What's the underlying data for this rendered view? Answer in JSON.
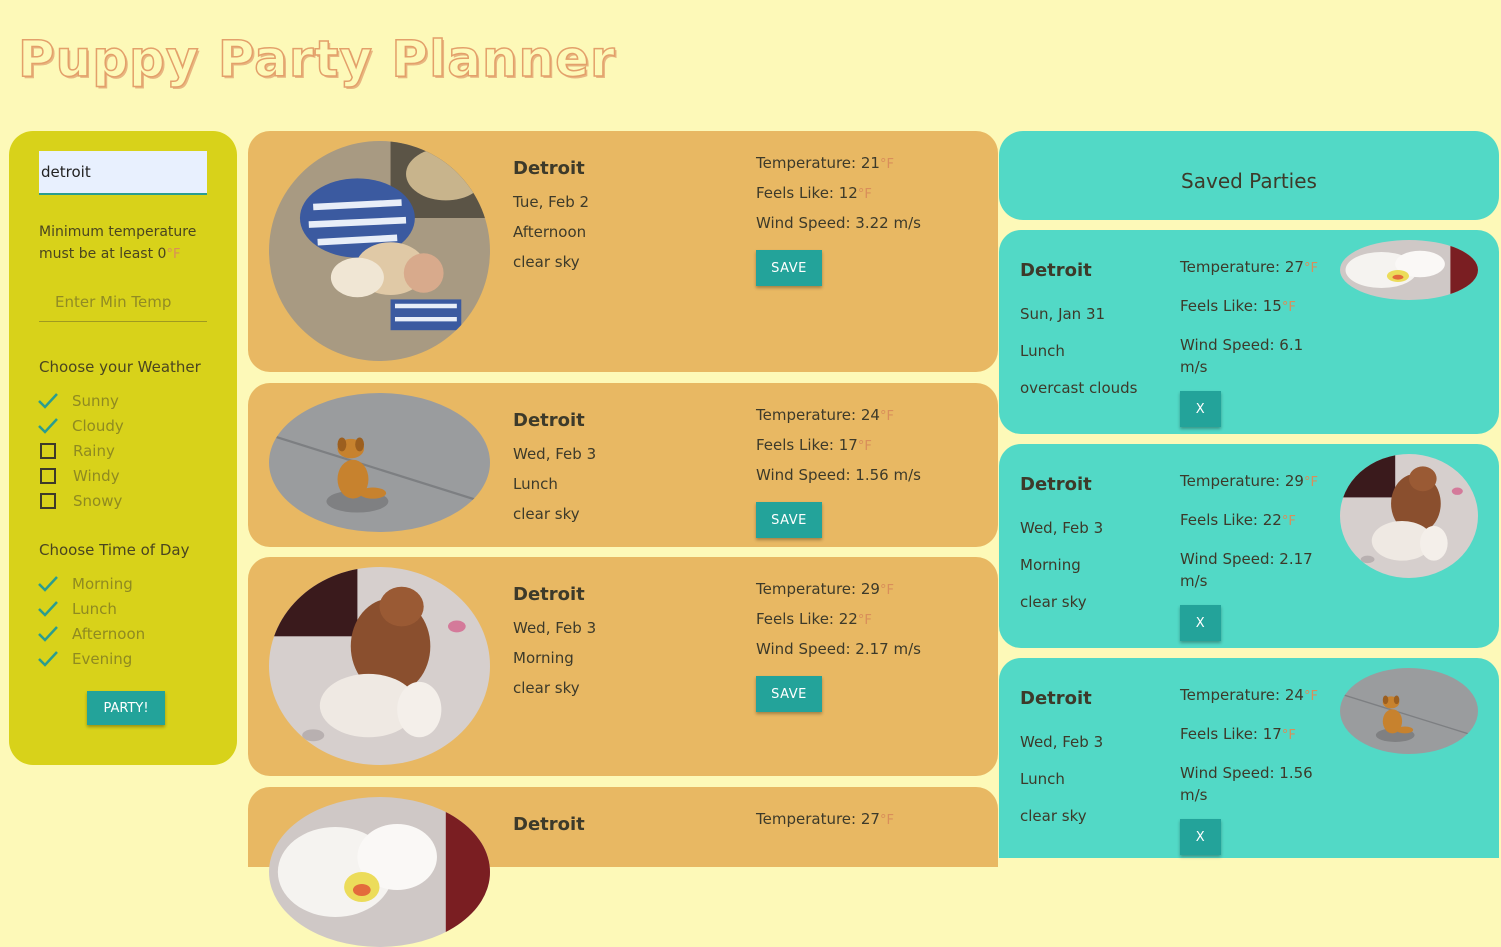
{
  "app": {
    "title": "Puppy Party Planner"
  },
  "sidebar": {
    "city_value": "detroit",
    "min_temp_note_prefix": "Minimum temperature must be at least 0",
    "unit": "°F",
    "min_temp_placeholder": "Enter Min Temp",
    "weather_title": "Choose your Weather",
    "weather_options": [
      {
        "label": "Sunny",
        "checked": true
      },
      {
        "label": "Cloudy",
        "checked": true
      },
      {
        "label": "Rainy",
        "checked": false
      },
      {
        "label": "Windy",
        "checked": false
      },
      {
        "label": "Snowy",
        "checked": false
      }
    ],
    "time_title": "Choose Time of Day",
    "time_options": [
      {
        "label": "Morning",
        "checked": true
      },
      {
        "label": "Lunch",
        "checked": true
      },
      {
        "label": "Afternoon",
        "checked": true
      },
      {
        "label": "Evening",
        "checked": true
      }
    ],
    "party_label": "PARTY!"
  },
  "results": [
    {
      "city": "Detroit",
      "date": "Tue, Feb 2",
      "time": "Afternoon",
      "desc": "clear sky",
      "temp_label": "Temperature: 21",
      "feels_label": "Feels Like: 12",
      "wind_label": "Wind Speed: 3.22 m/s",
      "unit": "°F",
      "save_label": "SAVE",
      "photo": "puppies-with-person"
    },
    {
      "city": "Detroit",
      "date": "Wed, Feb 3",
      "time": "Lunch",
      "desc": "clear sky",
      "temp_label": "Temperature: 24",
      "feels_label": "Feels Like: 17",
      "wind_label": "Wind Speed: 1.56 m/s",
      "unit": "°F",
      "save_label": "SAVE",
      "photo": "puppy-on-pavement"
    },
    {
      "city": "Detroit",
      "date": "Wed, Feb 3",
      "time": "Morning",
      "desc": "clear sky",
      "temp_label": "Temperature: 29",
      "feels_label": "Feels Like: 22",
      "wind_label": "Wind Speed: 2.17 m/s",
      "unit": "°F",
      "save_label": "SAVE",
      "photo": "puppy-on-blanket"
    },
    {
      "city": "Detroit",
      "temp_label": "Temperature: 27",
      "unit": "°F",
      "photo": "white-puppy"
    }
  ],
  "saved": {
    "title": "Saved Parties",
    "items": [
      {
        "city": "Detroit",
        "date": "Sun, Jan 31",
        "time": "Lunch",
        "desc": "overcast clouds",
        "temp_label": "Temperature: 27",
        "feels_label": "Feels Like: 15",
        "wind_label": "Wind Speed: 6.1 m/s",
        "unit": "°F",
        "remove_label": "X",
        "photo": "white-puppy"
      },
      {
        "city": "Detroit",
        "date": "Wed, Feb 3",
        "time": "Morning",
        "desc": "clear sky",
        "temp_label": "Temperature: 29",
        "feels_label": "Feels Like: 22",
        "wind_label": "Wind Speed: 2.17 m/s",
        "unit": "°F",
        "remove_label": "X",
        "photo": "puppy-on-blanket"
      },
      {
        "city": "Detroit",
        "date": "Wed, Feb 3",
        "time": "Lunch",
        "desc": "clear sky",
        "temp_label": "Temperature: 24",
        "feels_label": "Feels Like: 17",
        "wind_label": "Wind Speed: 1.56 m/s",
        "unit": "°F",
        "remove_label": "X",
        "photo": "puppy-on-pavement"
      }
    ]
  },
  "colors": {
    "page_bg": "#fdf9b8",
    "sidebar_bg": "#d8d21a",
    "result_bg": "#e8b863",
    "saved_bg": "#52d9c6",
    "button": "#23a39a",
    "unit_accent": "#d98e5a"
  }
}
